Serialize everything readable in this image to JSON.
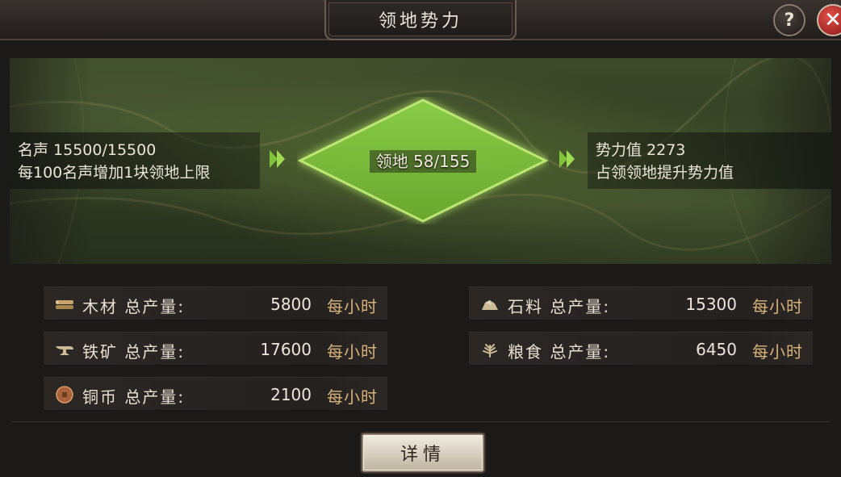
{
  "header": {
    "title": "领地势力",
    "help_label": "?",
    "close_label": "✕"
  },
  "banner": {
    "left": {
      "line1": "名声 15500/15500",
      "line2": "每100名声增加1块领地上限"
    },
    "center": {
      "label": "领地 58/155"
    },
    "right": {
      "line1": "势力值 2273",
      "line2": "占领领地提升势力值"
    }
  },
  "resources": [
    {
      "icon": "wood-icon",
      "name": "木材 总产量:",
      "value": "5800",
      "unit": "每小时"
    },
    {
      "icon": "stone-icon",
      "name": "石料 总产量:",
      "value": "15300",
      "unit": "每小时"
    },
    {
      "icon": "iron-icon",
      "name": "铁矿 总产量:",
      "value": "17600",
      "unit": "每小时"
    },
    {
      "icon": "grain-icon",
      "name": "粮食 总产量:",
      "value": "6450",
      "unit": "每小时"
    },
    {
      "icon": "coin-icon",
      "name": "铜币 总产量:",
      "value": "2100",
      "unit": "每小时"
    }
  ],
  "footer": {
    "detail_label": "详情"
  },
  "colors": {
    "territory_green": "#7fc43a",
    "unit_gold": "#d9b37a",
    "close_red": "#c8302a"
  }
}
